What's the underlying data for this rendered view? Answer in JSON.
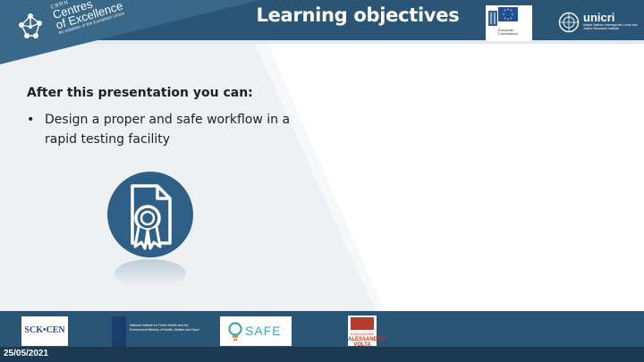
{
  "header": {
    "title": "Learning objectives",
    "background_color": "#2b5575"
  },
  "logos": {
    "coe": {
      "small": "CBRN",
      "line1": "Centres",
      "line2": "of Excellence",
      "tagline": "An initiative of the European Union"
    },
    "eu": {
      "label": "European Commission"
    },
    "unicri": {
      "name": "unicri",
      "sub": "United Nations Interregional Crime and Justice Research Institute"
    }
  },
  "content": {
    "subtitle": "After this presentation you can:",
    "bullets": [
      {
        "marker": "•",
        "text": "Design a proper and safe workflow in a rapid testing facility"
      }
    ],
    "icon": "certificate-document-icon"
  },
  "footer": {
    "date": "25/05/2021",
    "partners": {
      "sck": "SCK•CEN",
      "rivm": "National Institute for Public Health and the Environment Ministry of Health, Welfare and Sport",
      "safe": "SAFE",
      "volta_top": "FONDAZIONE",
      "volta_name": "ALESSANDRO VOLTA"
    }
  },
  "colors": {
    "primary_blue": "#2b5575",
    "dark_blue": "#1b3a52",
    "panel_gray": "#eef1f4",
    "icon_blue": "#2e5f86"
  }
}
